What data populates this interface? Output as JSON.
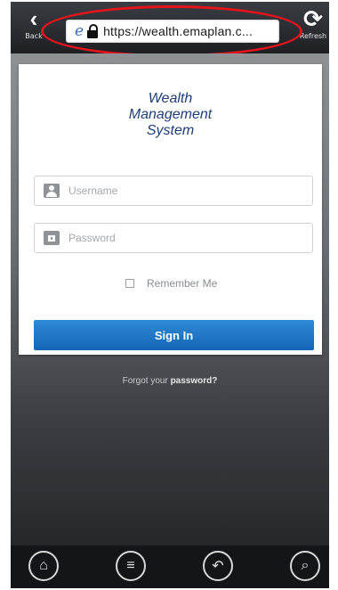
{
  "browser": {
    "back_label": "Back",
    "refresh_label": "Refresh",
    "url": "https://wealth.emaplan.c...",
    "back_icon": "chevron-left-icon",
    "refresh_icon": "refresh-icon",
    "security_icons": [
      "ie-icon",
      "lock-icon"
    ],
    "highlight_color": "#e3141b"
  },
  "login": {
    "logo_lines": [
      "Wealth",
      "Management",
      "System"
    ],
    "username_placeholder": "Username",
    "password_placeholder": "Password",
    "remember_label": "Remember Me",
    "remember_checked": false,
    "signin_label": "Sign In",
    "forgot_prefix": "Forgot your",
    "forgot_strong": "password?",
    "accent_color": "#1a74c4"
  },
  "bottom_nav": {
    "icons": [
      "home-icon",
      "menu-icon",
      "return-icon",
      "search-icon"
    ]
  }
}
